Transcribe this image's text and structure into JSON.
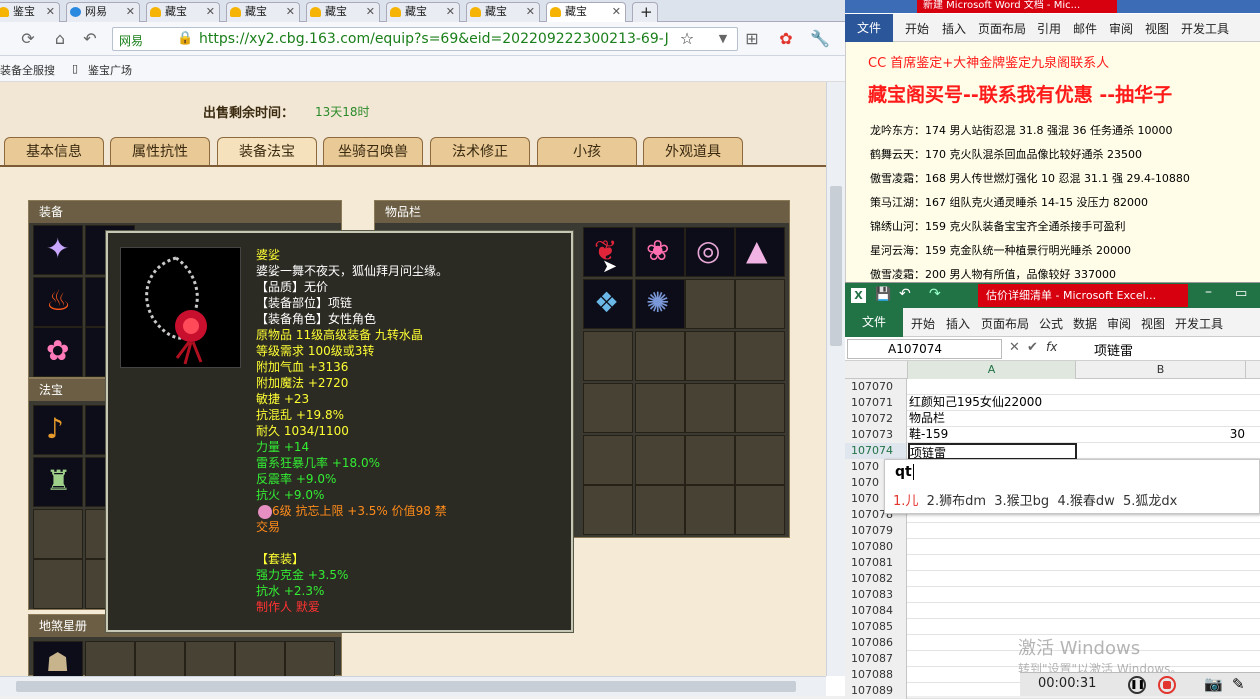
{
  "browser": {
    "tabs": [
      {
        "label": "鉴宝"
      },
      {
        "label": "网易"
      },
      {
        "label": "藏宝"
      },
      {
        "label": "藏宝"
      },
      {
        "label": "藏宝"
      },
      {
        "label": "藏宝"
      },
      {
        "label": "藏宝"
      },
      {
        "label": "藏宝"
      }
    ],
    "new_tab": "+",
    "site_badge": "网易",
    "url": "https://xy2.cbg.163.com/equip?s=69&eid=202209222300213-69-J",
    "bookmarks": [
      "装备全服搜",
      "鉴宝广场"
    ]
  },
  "page": {
    "sale_label": "出售剩余时间：",
    "sale_value": "13天18时",
    "tabs": [
      "基本信息",
      "属性抗性",
      "装备法宝",
      "坐骑召唤兽",
      "法术修正",
      "小孩",
      "外观道具"
    ],
    "equip_header": "装备",
    "item_header": "物品栏",
    "fabao_header": "法宝",
    "star_header": "地煞星册"
  },
  "tooltip": {
    "lines": [
      {
        "text": "婆娑",
        "color": "#ffff33"
      },
      {
        "text": "婆娑一舞不夜天，狐仙拜月问尘缘。",
        "color": "#ffffff"
      },
      {
        "text": "【品质】无价",
        "color": "#ffffff"
      },
      {
        "text": "【装备部位】项链",
        "color": "#ffffff"
      },
      {
        "text": "【装备角色】女性角色",
        "color": "#ffffff"
      },
      {
        "text": "原物品 11级高级装备 九转水晶",
        "color": "#ffff33"
      },
      {
        "text": "等级需求 100级或3转",
        "color": "#ffff33"
      },
      {
        "text": "附加气血 +3136",
        "color": "#ffff33"
      },
      {
        "text": "附加魔法 +2720",
        "color": "#ffff33"
      },
      {
        "text": "敏捷 +23",
        "color": "#ffff33"
      },
      {
        "text": "抗混乱 +19.8%",
        "color": "#ffff33"
      },
      {
        "text": "耐久 1034/1100",
        "color": "#ffff33"
      },
      {
        "text": "力量 +14",
        "color": "#33ee33"
      },
      {
        "text": "雷系狂暴几率 +18.0%",
        "color": "#33ee33"
      },
      {
        "text": "反震率 +9.0%",
        "color": "#33ee33"
      },
      {
        "text": "抗火 +9.0%",
        "color": "#33ee33"
      },
      {
        "text": "6级 抗忘上限 +3.5% 价值98 禁",
        "color": "#ff8c1a"
      },
      {
        "text": "交易",
        "color": "#ff8c1a"
      },
      {
        "text": "",
        "color": "#ffffff"
      },
      {
        "text": "【套装】",
        "color": "#ffff33"
      },
      {
        "text": "强力克金 +3.5%",
        "color": "#33ee33"
      },
      {
        "text": "抗水 +2.3%",
        "color": "#33ee33"
      },
      {
        "text": "制作人 默爱",
        "color": "#ff3333"
      }
    ]
  },
  "word": {
    "title": "新建 Microsoft Word 文档 - Mic...",
    "file_tab": "文件",
    "tabs": [
      "开始",
      "插入",
      "页面布局",
      "引用",
      "邮件",
      "审阅",
      "视图",
      "开发工具"
    ],
    "headline1": "CC 首席鉴定+大神金牌鉴定九泉阁联系人",
    "headline2": "藏宝阁买号--联系我有优惠 --抽华子",
    "lines": [
      "龙吟东方：174 男人站街忍混 31.8 强混 36 任务通杀 10000",
      "鹤舞云天：170 克火队混杀回血品像比较好通杀 23500",
      "傲雪凌霜：168 男人传世燃灯强化 10 忍混 31.1 强 29.4-10880",
      "策马江湖：167 组队克火通灵睡杀 14-15 没压力 82000",
      "锦绣山河：159 克火队装备宝宝齐全通杀接手可盈利",
      "星河云海：159 克金队统一种植景行明光睡杀 20000",
      "傲雪凌霜：200 男人物有所值，品像较好 337000"
    ]
  },
  "excel": {
    "title": "估价详细清单 - Microsoft Excel...",
    "file_tab": "文件",
    "tabs": [
      "开始",
      "插入",
      "页面布局",
      "公式",
      "数据",
      "审阅",
      "视图",
      "开发工具"
    ],
    "name_box": "A107074",
    "fx": "fx",
    "formula_value": "项链雷",
    "col_a": "A",
    "col_b": "B",
    "rows": [
      {
        "num": "107070",
        "a": "",
        "b": ""
      },
      {
        "num": "107071",
        "a": "红颜知己195女仙22000",
        "b": ""
      },
      {
        "num": "107072",
        "a": "物品栏",
        "b": ""
      },
      {
        "num": "107073",
        "a": "鞋-159",
        "b": "30"
      },
      {
        "num": "107074",
        "a": "项链雷",
        "b": ""
      },
      {
        "num": "1070",
        "a": "",
        "b": ""
      },
      {
        "num": "1070",
        "a": "",
        "b": ""
      },
      {
        "num": "1070",
        "a": "",
        "b": ""
      },
      {
        "num": "107078",
        "a": "",
        "b": ""
      },
      {
        "num": "107079",
        "a": "",
        "b": ""
      },
      {
        "num": "107080",
        "a": "",
        "b": ""
      },
      {
        "num": "107081",
        "a": "",
        "b": ""
      },
      {
        "num": "107082",
        "a": "",
        "b": ""
      },
      {
        "num": "107083",
        "a": "",
        "b": ""
      },
      {
        "num": "107084",
        "a": "",
        "b": ""
      },
      {
        "num": "107085",
        "a": "",
        "b": ""
      },
      {
        "num": "107086",
        "a": "",
        "b": ""
      },
      {
        "num": "107087",
        "a": "",
        "b": ""
      },
      {
        "num": "107088",
        "a": "",
        "b": ""
      },
      {
        "num": "107089",
        "a": "",
        "b": ""
      }
    ]
  },
  "ime": {
    "input": "qt",
    "candidates": [
      "1.儿",
      "2.狮布dm",
      "3.猴卫bg",
      "4.猴春dw",
      "5.狐龙dx"
    ]
  },
  "system": {
    "watermark1": "激活 Windows",
    "watermark2": "转到\"设置\"以激活 Windows。",
    "timer": "00:00:31"
  }
}
